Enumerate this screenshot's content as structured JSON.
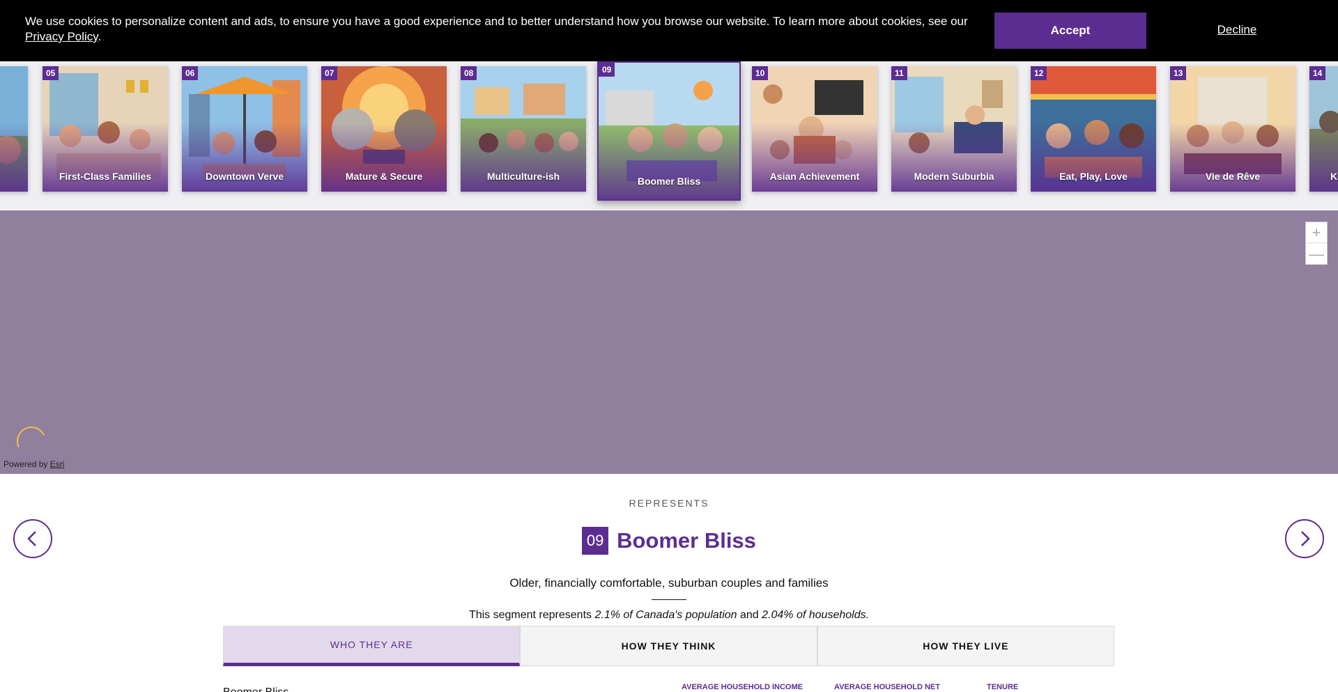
{
  "cookie": {
    "message": "We use cookies to personalize content and ads, to ensure you have a good experience and to better understand how you browse our website. To learn more about cookies, see our ",
    "policy_link": "Privacy Policy",
    "period": ".",
    "accept": "Accept",
    "decline": "Decline"
  },
  "segments": [
    {
      "num": "05",
      "name": "First-Class Families"
    },
    {
      "num": "06",
      "name": "Downtown Verve"
    },
    {
      "num": "07",
      "name": "Mature & Secure"
    },
    {
      "num": "08",
      "name": "Multiculture-ish"
    },
    {
      "num": "09",
      "name": "Boomer Bliss"
    },
    {
      "num": "10",
      "name": "Asian Achievement"
    },
    {
      "num": "11",
      "name": "Modern Suburbia"
    },
    {
      "num": "12",
      "name": "Eat, Play, Love"
    },
    {
      "num": "13",
      "name": "Vie de Rêve"
    },
    {
      "num": "14",
      "name": "K"
    }
  ],
  "map": {
    "zoom_in": "+",
    "zoom_out": "—",
    "attribution_prefix": "Powered by ",
    "attribution_link": "Esri"
  },
  "detail": {
    "eyebrow": "REPRESENTS",
    "number": "09",
    "name": "Boomer Bliss",
    "tagline": "Older, financially comfortable, suburban couples and families",
    "stat_prefix": "This segment represents ",
    "stat_pop": "2.1% of Canada's population",
    "stat_mid": " and ",
    "stat_hh": "2.04% of households.",
    "tabs": [
      "WHO THEY ARE",
      "HOW THEY THINK",
      "HOW THEY LIVE"
    ],
    "active_tab": 0,
    "peek_body": "Boomer Bliss",
    "peek_labels": [
      "AVERAGE HOUSEHOLD INCOME",
      "AVERAGE HOUSEHOLD NET",
      "TENURE"
    ]
  },
  "colors": {
    "brand": "#5c2d91",
    "map_fill": "#907f9d",
    "cookie_bg": "#000000"
  }
}
